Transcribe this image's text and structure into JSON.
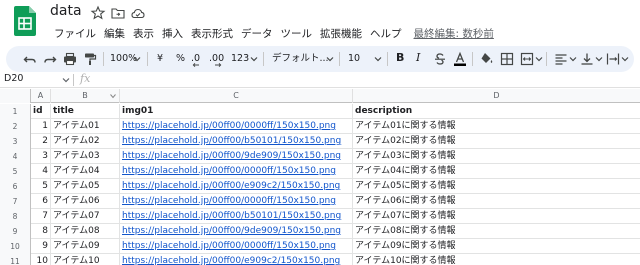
{
  "app": {
    "title": "data"
  },
  "menu": {
    "items": [
      "ファイル",
      "編集",
      "表示",
      "挿入",
      "表示形式",
      "データ",
      "ツール",
      "拡張機能",
      "ヘルプ"
    ],
    "last_edit": "最終編集: 数秒前"
  },
  "toolbar": {
    "zoom": "100%",
    "currency": "¥",
    "percent": "%",
    "dec_decrease": ".0",
    "dec_increase": ".00",
    "more_formats": "123",
    "font": "デフォルト...",
    "font_size": "10",
    "bold": "B",
    "italic": "I"
  },
  "formula_bar": {
    "name_box": "D20",
    "fx": "fx"
  },
  "columns": [
    "A",
    "B",
    "C",
    "D"
  ],
  "rows": [
    {
      "num": "1",
      "id": "id",
      "title": "title",
      "img": "img01",
      "desc": "description"
    },
    {
      "num": "2",
      "id": "1",
      "title": "アイテム01",
      "img": "https://placehold.jp/00ff00/0000ff/150x150.png",
      "desc": "アイテム01に関する情報"
    },
    {
      "num": "3",
      "id": "2",
      "title": "アイテム02",
      "img": "https://placehold.jp/00ff00/b50101/150x150.png",
      "desc": "アイテム02に関する情報"
    },
    {
      "num": "4",
      "id": "3",
      "title": "アイテム03",
      "img": "https://placehold.jp/00ff00/9de909/150x150.png",
      "desc": "アイテム03に関する情報"
    },
    {
      "num": "5",
      "id": "4",
      "title": "アイテム04",
      "img": "https://placehold.jp/00ff00/0000ff/150x150.png",
      "desc": "アイテム04に関する情報"
    },
    {
      "num": "6",
      "id": "5",
      "title": "アイテム05",
      "img": "https://placehold.jp/00ff00/e909c2/150x150.png",
      "desc": "アイテム05に関する情報"
    },
    {
      "num": "7",
      "id": "6",
      "title": "アイテム06",
      "img": "https://placehold.jp/00ff00/0000ff/150x150.png",
      "desc": "アイテム06に関する情報"
    },
    {
      "num": "8",
      "id": "7",
      "title": "アイテム07",
      "img": "https://placehold.jp/00ff00/b50101/150x150.png",
      "desc": "アイテム07に関する情報"
    },
    {
      "num": "9",
      "id": "8",
      "title": "アイテム08",
      "img": "https://placehold.jp/00ff00/9de909/150x150.png",
      "desc": "アイテム08に関する情報"
    },
    {
      "num": "10",
      "id": "9",
      "title": "アイテム09",
      "img": "https://placehold.jp/00ff00/0000ff/150x150.png",
      "desc": "アイテム09に関する情報"
    },
    {
      "num": "11",
      "id": "10",
      "title": "アイテム10",
      "img": "https://placehold.jp/00ff00/e909c2/150x150.png",
      "desc": "アイテム10に関する情報"
    }
  ],
  "colors": {
    "sheets_green": "#0f9d58",
    "link": "#1155cc",
    "toolbar_bg": "#edf2fa"
  }
}
